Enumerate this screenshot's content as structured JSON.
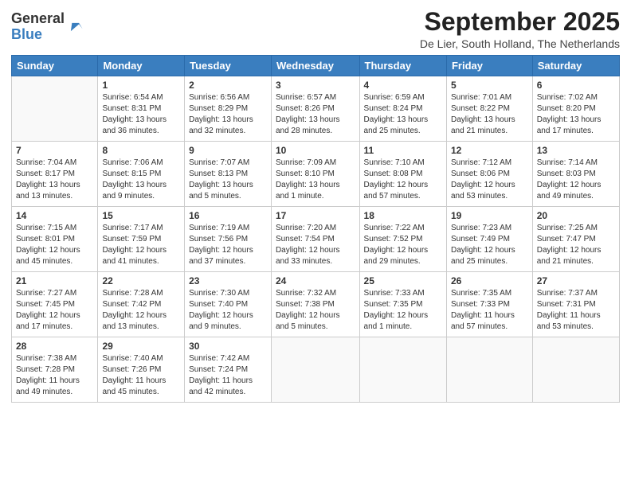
{
  "header": {
    "logo_general": "General",
    "logo_blue": "Blue",
    "month_title": "September 2025",
    "location": "De Lier, South Holland, The Netherlands"
  },
  "weekdays": [
    "Sunday",
    "Monday",
    "Tuesday",
    "Wednesday",
    "Thursday",
    "Friday",
    "Saturday"
  ],
  "weeks": [
    [
      {
        "day": "",
        "info": ""
      },
      {
        "day": "1",
        "info": "Sunrise: 6:54 AM\nSunset: 8:31 PM\nDaylight: 13 hours\nand 36 minutes."
      },
      {
        "day": "2",
        "info": "Sunrise: 6:56 AM\nSunset: 8:29 PM\nDaylight: 13 hours\nand 32 minutes."
      },
      {
        "day": "3",
        "info": "Sunrise: 6:57 AM\nSunset: 8:26 PM\nDaylight: 13 hours\nand 28 minutes."
      },
      {
        "day": "4",
        "info": "Sunrise: 6:59 AM\nSunset: 8:24 PM\nDaylight: 13 hours\nand 25 minutes."
      },
      {
        "day": "5",
        "info": "Sunrise: 7:01 AM\nSunset: 8:22 PM\nDaylight: 13 hours\nand 21 minutes."
      },
      {
        "day": "6",
        "info": "Sunrise: 7:02 AM\nSunset: 8:20 PM\nDaylight: 13 hours\nand 17 minutes."
      }
    ],
    [
      {
        "day": "7",
        "info": "Sunrise: 7:04 AM\nSunset: 8:17 PM\nDaylight: 13 hours\nand 13 minutes."
      },
      {
        "day": "8",
        "info": "Sunrise: 7:06 AM\nSunset: 8:15 PM\nDaylight: 13 hours\nand 9 minutes."
      },
      {
        "day": "9",
        "info": "Sunrise: 7:07 AM\nSunset: 8:13 PM\nDaylight: 13 hours\nand 5 minutes."
      },
      {
        "day": "10",
        "info": "Sunrise: 7:09 AM\nSunset: 8:10 PM\nDaylight: 13 hours\nand 1 minute."
      },
      {
        "day": "11",
        "info": "Sunrise: 7:10 AM\nSunset: 8:08 PM\nDaylight: 12 hours\nand 57 minutes."
      },
      {
        "day": "12",
        "info": "Sunrise: 7:12 AM\nSunset: 8:06 PM\nDaylight: 12 hours\nand 53 minutes."
      },
      {
        "day": "13",
        "info": "Sunrise: 7:14 AM\nSunset: 8:03 PM\nDaylight: 12 hours\nand 49 minutes."
      }
    ],
    [
      {
        "day": "14",
        "info": "Sunrise: 7:15 AM\nSunset: 8:01 PM\nDaylight: 12 hours\nand 45 minutes."
      },
      {
        "day": "15",
        "info": "Sunrise: 7:17 AM\nSunset: 7:59 PM\nDaylight: 12 hours\nand 41 minutes."
      },
      {
        "day": "16",
        "info": "Sunrise: 7:19 AM\nSunset: 7:56 PM\nDaylight: 12 hours\nand 37 minutes."
      },
      {
        "day": "17",
        "info": "Sunrise: 7:20 AM\nSunset: 7:54 PM\nDaylight: 12 hours\nand 33 minutes."
      },
      {
        "day": "18",
        "info": "Sunrise: 7:22 AM\nSunset: 7:52 PM\nDaylight: 12 hours\nand 29 minutes."
      },
      {
        "day": "19",
        "info": "Sunrise: 7:23 AM\nSunset: 7:49 PM\nDaylight: 12 hours\nand 25 minutes."
      },
      {
        "day": "20",
        "info": "Sunrise: 7:25 AM\nSunset: 7:47 PM\nDaylight: 12 hours\nand 21 minutes."
      }
    ],
    [
      {
        "day": "21",
        "info": "Sunrise: 7:27 AM\nSunset: 7:45 PM\nDaylight: 12 hours\nand 17 minutes."
      },
      {
        "day": "22",
        "info": "Sunrise: 7:28 AM\nSunset: 7:42 PM\nDaylight: 12 hours\nand 13 minutes."
      },
      {
        "day": "23",
        "info": "Sunrise: 7:30 AM\nSunset: 7:40 PM\nDaylight: 12 hours\nand 9 minutes."
      },
      {
        "day": "24",
        "info": "Sunrise: 7:32 AM\nSunset: 7:38 PM\nDaylight: 12 hours\nand 5 minutes."
      },
      {
        "day": "25",
        "info": "Sunrise: 7:33 AM\nSunset: 7:35 PM\nDaylight: 12 hours\nand 1 minute."
      },
      {
        "day": "26",
        "info": "Sunrise: 7:35 AM\nSunset: 7:33 PM\nDaylight: 11 hours\nand 57 minutes."
      },
      {
        "day": "27",
        "info": "Sunrise: 7:37 AM\nSunset: 7:31 PM\nDaylight: 11 hours\nand 53 minutes."
      }
    ],
    [
      {
        "day": "28",
        "info": "Sunrise: 7:38 AM\nSunset: 7:28 PM\nDaylight: 11 hours\nand 49 minutes."
      },
      {
        "day": "29",
        "info": "Sunrise: 7:40 AM\nSunset: 7:26 PM\nDaylight: 11 hours\nand 45 minutes."
      },
      {
        "day": "30",
        "info": "Sunrise: 7:42 AM\nSunset: 7:24 PM\nDaylight: 11 hours\nand 42 minutes."
      },
      {
        "day": "",
        "info": ""
      },
      {
        "day": "",
        "info": ""
      },
      {
        "day": "",
        "info": ""
      },
      {
        "day": "",
        "info": ""
      }
    ]
  ]
}
